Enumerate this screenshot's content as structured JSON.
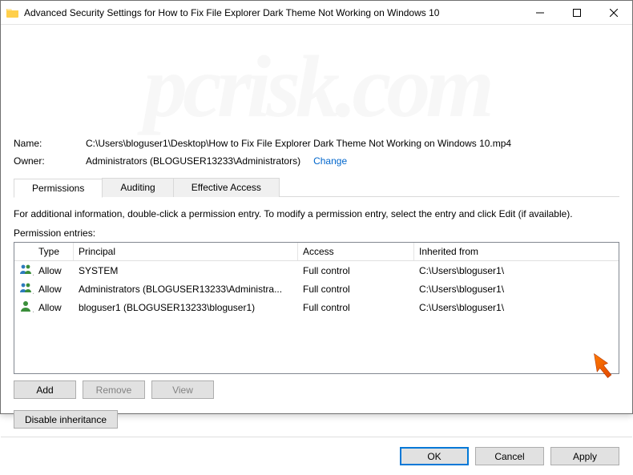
{
  "window": {
    "title": "Advanced Security Settings for How to Fix File Explorer Dark Theme Not Working on Windows 10"
  },
  "info": {
    "name_label": "Name:",
    "name_value": "C:\\Users\\bloguser1\\Desktop\\How to Fix File Explorer Dark Theme Not Working on Windows 10.mp4",
    "owner_label": "Owner:",
    "owner_value": "Administrators (BLOGUSER13233\\Administrators)",
    "change_link": "Change"
  },
  "tabs": {
    "permissions": "Permissions",
    "auditing": "Auditing",
    "effective": "Effective Access"
  },
  "instruction": "For additional information, double-click a permission entry. To modify a permission entry, select the entry and click Edit (if available).",
  "entries_label": "Permission entries:",
  "headers": {
    "type": "Type",
    "principal": "Principal",
    "access": "Access",
    "inherited": "Inherited from"
  },
  "entries": [
    {
      "type": "Allow",
      "principal": "SYSTEM",
      "access": "Full control",
      "inherited": "C:\\Users\\bloguser1\\",
      "icon": "group"
    },
    {
      "type": "Allow",
      "principal": "Administrators (BLOGUSER13233\\Administra...",
      "access": "Full control",
      "inherited": "C:\\Users\\bloguser1\\",
      "icon": "group"
    },
    {
      "type": "Allow",
      "principal": "bloguser1 (BLOGUSER13233\\bloguser1)",
      "access": "Full control",
      "inherited": "C:\\Users\\bloguser1\\",
      "icon": "user"
    }
  ],
  "buttons": {
    "add": "Add",
    "remove": "Remove",
    "view": "View",
    "disable_inheritance": "Disable inheritance",
    "ok": "OK",
    "cancel": "Cancel",
    "apply": "Apply"
  },
  "watermark": "pcrisk.com"
}
